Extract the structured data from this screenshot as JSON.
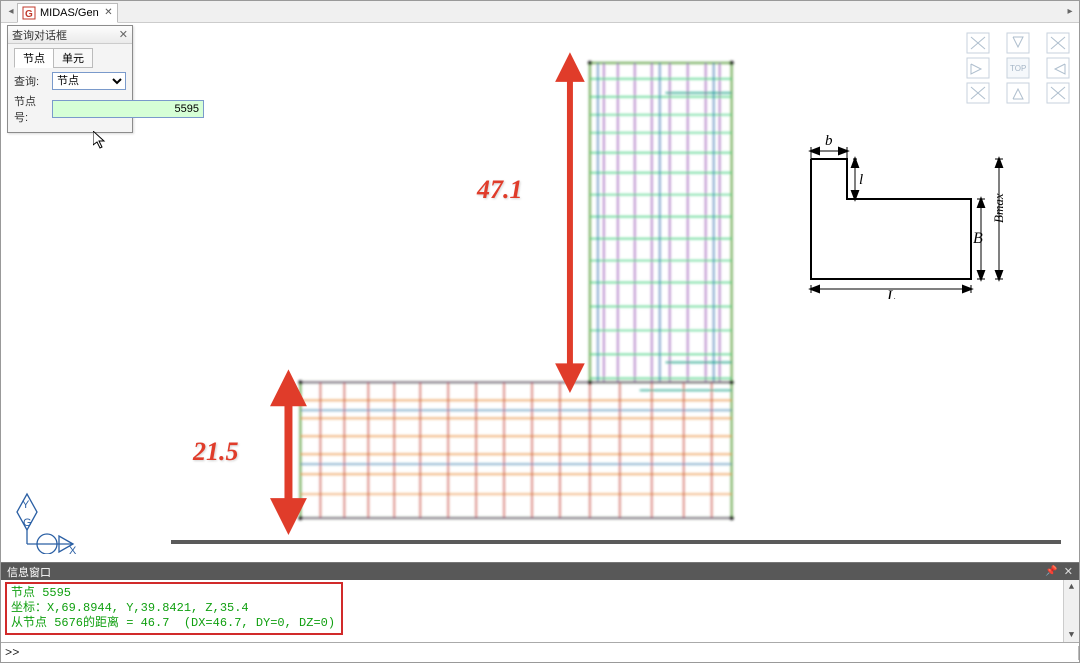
{
  "tab": {
    "title": "MIDAS/Gen"
  },
  "dialog": {
    "title": "查询对话框",
    "tabs": [
      "节点",
      "单元"
    ],
    "active_tab": 0,
    "query_label": "查询:",
    "query_select": {
      "value": "节点",
      "options": [
        "节点"
      ]
    },
    "node_no_label": "节点号:",
    "node_no_value": "5595"
  },
  "viewcube": {
    "labels": [
      "TOP"
    ]
  },
  "canvas": {
    "dim_v": "47.1",
    "dim_h": "21.5",
    "red_arrow_color": "#e03c2a"
  },
  "section": {
    "b_label": "b",
    "l_label": "l",
    "B_label": "B",
    "Bmax_label": "Bmax",
    "L_label": "L"
  },
  "ucs": {
    "x": "X",
    "y": "Y",
    "g": "G"
  },
  "info": {
    "title": "信息窗口",
    "lines": [
      "节点 5595",
      "坐标：X,69.8944, Y,39.8421, Z,35.4",
      "从节点 5676的距离 = 46.7  (DX=46.7, DY=0, DZ=0)"
    ]
  },
  "cmd": {
    "prompt": ">>",
    "value": ""
  }
}
